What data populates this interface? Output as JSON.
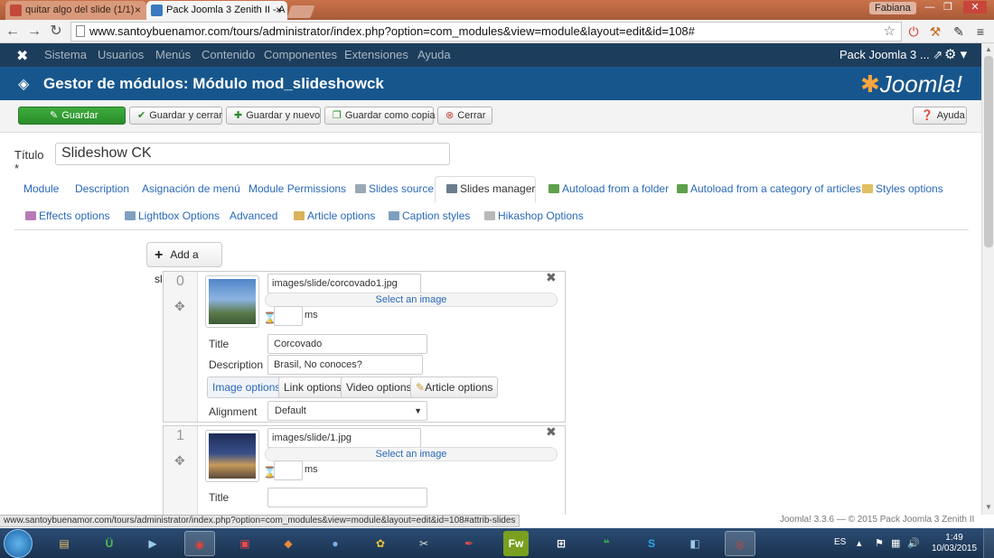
{
  "browser": {
    "tabs": [
      {
        "title": "quitar algo del slide (1/1)"
      },
      {
        "title": "Pack Joomla 3 Zenith II - A"
      }
    ],
    "user": "Fabiana",
    "url": "www.santoybuenamor.com/tours/administrator/index.php?option=com_modules&view=module&layout=edit&id=108#",
    "status_url": "www.santoybuenamor.com/tours/administrator/index.php?option=com_modules&view=module&layout=edit&id=108#attrib-slides"
  },
  "joomla": {
    "menu": [
      "Sistema",
      "Usuarios",
      "Menús",
      "Contenido",
      "Componentes",
      "Extensiones",
      "Ayuda"
    ],
    "site_name": "Pack Joomla 3 ...",
    "page_title": "Gestor de módulos: Módulo mod_slideshowck",
    "logo_text": "Joomla!",
    "toolbar": {
      "save": "Guardar",
      "save_close": "Guardar y cerrar",
      "save_new": "Guardar y nuevo",
      "save_copy": "Guardar como copia",
      "close": "Cerrar",
      "help": "Ayuda"
    },
    "title_label": "Título *",
    "title_value": "Slideshow CK",
    "tabs_row1": [
      "Module",
      "Description",
      "Asignación de menú",
      "Module Permissions",
      "Slides source",
      "Slides manager",
      "Autoload from a folder",
      "Autoload from a category of articles",
      "Styles options"
    ],
    "tabs_row2": [
      "Effects options",
      "Lightbox Options",
      "Advanced",
      "Article options",
      "Caption styles",
      "Hikashop Options"
    ],
    "add_slide": "Add a slide",
    "slides": [
      {
        "index": "0",
        "image_path": "images/slide/corcovado1.jpg",
        "select_image": "Select an image",
        "ms_label": "ms",
        "title_label": "Title",
        "title_value": "Corcovado",
        "description_label": "Description",
        "description_value": "Brasil, No conoces?",
        "options": [
          "Image options",
          "Link options",
          "Video options",
          "Article options"
        ],
        "alignment_label": "Alignment",
        "alignment_value": "Default"
      },
      {
        "index": "1",
        "image_path": "images/slide/1.jpg",
        "select_image": "Select an image",
        "ms_label": "ms",
        "title_label": "Title",
        "title_value": ""
      }
    ],
    "footer": "Joomla! 3.3.6 — © 2015 Pack Joomla 3 Zenith II"
  },
  "taskbar": {
    "lang": "ES",
    "time": "1:49",
    "date": "10/03/2015"
  },
  "colors": {
    "nav_bg": "#1c3d5c",
    "title_bg": "#17568c",
    "save_green": "#2a8c2a",
    "link_blue": "#2a69b8"
  }
}
